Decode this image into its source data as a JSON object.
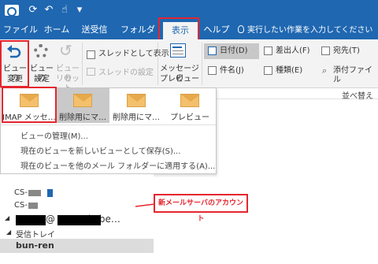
{
  "titlebar": {
    "icons": [
      "outlook-icon",
      "sync-icon",
      "undo-icon",
      "touch-icon",
      "dropdown-icon"
    ],
    "icon_glyphs": [
      "",
      "⟳",
      "↶",
      "☝",
      "▾"
    ]
  },
  "tabs": [
    {
      "label": "ファイル"
    },
    {
      "label": "ホーム"
    },
    {
      "label": "送受信"
    },
    {
      "label": "フォルダー"
    },
    {
      "label": "表示",
      "active": true
    },
    {
      "label": "ヘルプ"
    }
  ],
  "tell_me": {
    "label": "実行したい作業を入力してください",
    "icon": "lightbulb-icon"
  },
  "ribbon": {
    "change_view": {
      "line1": "ビューの",
      "line2": "変更"
    },
    "view_settings": {
      "line1": "ビューの",
      "line2": "設定"
    },
    "reset_view": {
      "line1": "ビューの",
      "line2": "リセット"
    },
    "show_as_threads": "スレッドとして表示",
    "thread_settings": "スレッドの設定",
    "message_preview": {
      "line1": "メッセージの",
      "line2": "プレビュー"
    },
    "arrangement": [
      "日付(D)",
      "差出人(F)",
      "宛先(T)",
      "件名(J)",
      "種類(E)",
      "添付ファイル"
    ],
    "sort_label": "並べ替え"
  },
  "dropdown": {
    "views": [
      {
        "label": "IMAP メッセ…",
        "highlighted": false
      },
      {
        "label": "削除用にマ…",
        "highlighted": true
      },
      {
        "label": "削除用にマ…",
        "highlighted": false
      },
      {
        "label": "プレビュー",
        "highlighted": false
      }
    ],
    "menu": [
      "ビューの管理(M)...",
      "現在のビューを新しいビューとして保存(S)...",
      "現在のビューを他のメール フォルダーに適用する(A)..."
    ]
  },
  "folders": {
    "items": [
      {
        "label": "CS-"
      },
      {
        "label": "CS-"
      },
      {
        "label": "@          .kobe…"
      },
      {
        "label": "受信トレイ"
      },
      {
        "label": "bun-ren"
      }
    ]
  },
  "callout": "新メールサーバのアカウント",
  "colors": {
    "accent": "#1f67b1",
    "highlight": "#e5262f",
    "envelope": "#f4c06b"
  }
}
